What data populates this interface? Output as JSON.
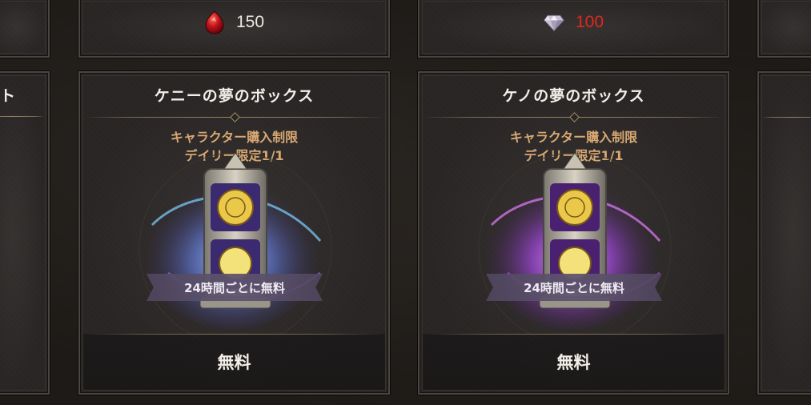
{
  "top_row": [
    {
      "amount": "",
      "currency": "none"
    },
    {
      "amount": "150",
      "currency": "red-gem-icon",
      "amount_color": "#ece8e2"
    },
    {
      "amount": "100",
      "currency": "diamond-icon",
      "amount_color": "#e0281c"
    },
    {
      "amount": "",
      "currency": "none"
    }
  ],
  "left_edge_card": {
    "title_fragment": "ト"
  },
  "shop_items": [
    {
      "title": "ケニーの夢のボックス",
      "limit_line1": "キャラクター購入制限",
      "limit_line2": "デイリー限定1/1",
      "ribbon": "24時間ごとに無料",
      "price": "無料",
      "aura_color": "#6fb6ff"
    },
    {
      "title": "ケノの夢のボックス",
      "limit_line1": "キャラクター購入制限",
      "limit_line2": "デイリー限定1/1",
      "ribbon": "24時間ごとに無料",
      "price": "無料",
      "aura_color": "#c44dff"
    }
  ],
  "colors": {
    "limit_text": "#d9a873",
    "price_red": "#e0281c",
    "card_border": "#4a4540"
  }
}
